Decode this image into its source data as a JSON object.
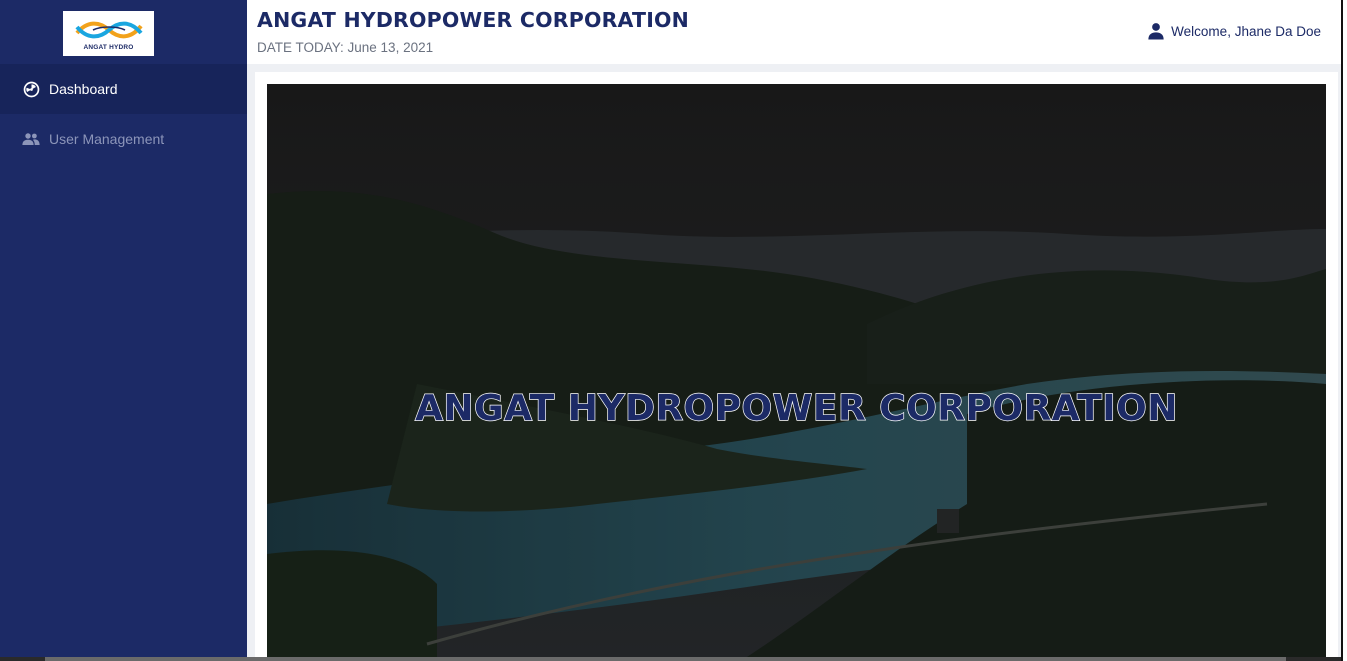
{
  "sidebar": {
    "logo_text": "ANGAT HYDRO",
    "items": [
      {
        "label": "Dashboard",
        "icon": "dashboard-icon",
        "active": true
      },
      {
        "label": "User Management",
        "icon": "users-icon",
        "active": false
      }
    ]
  },
  "header": {
    "title": "ANGAT HYDROPOWER CORPORATION",
    "date_text": "DATE TODAY: June 13, 2021",
    "welcome_text": "Welcome, Jhane Da Doe"
  },
  "hero": {
    "title": "ANGAT HYDROPOWER CORPORATION"
  },
  "colors": {
    "sidebar_bg": "#1c2a66",
    "sidebar_active": "#17245a",
    "accent": "#1c2a66",
    "content_bg": "#eef0f4"
  }
}
